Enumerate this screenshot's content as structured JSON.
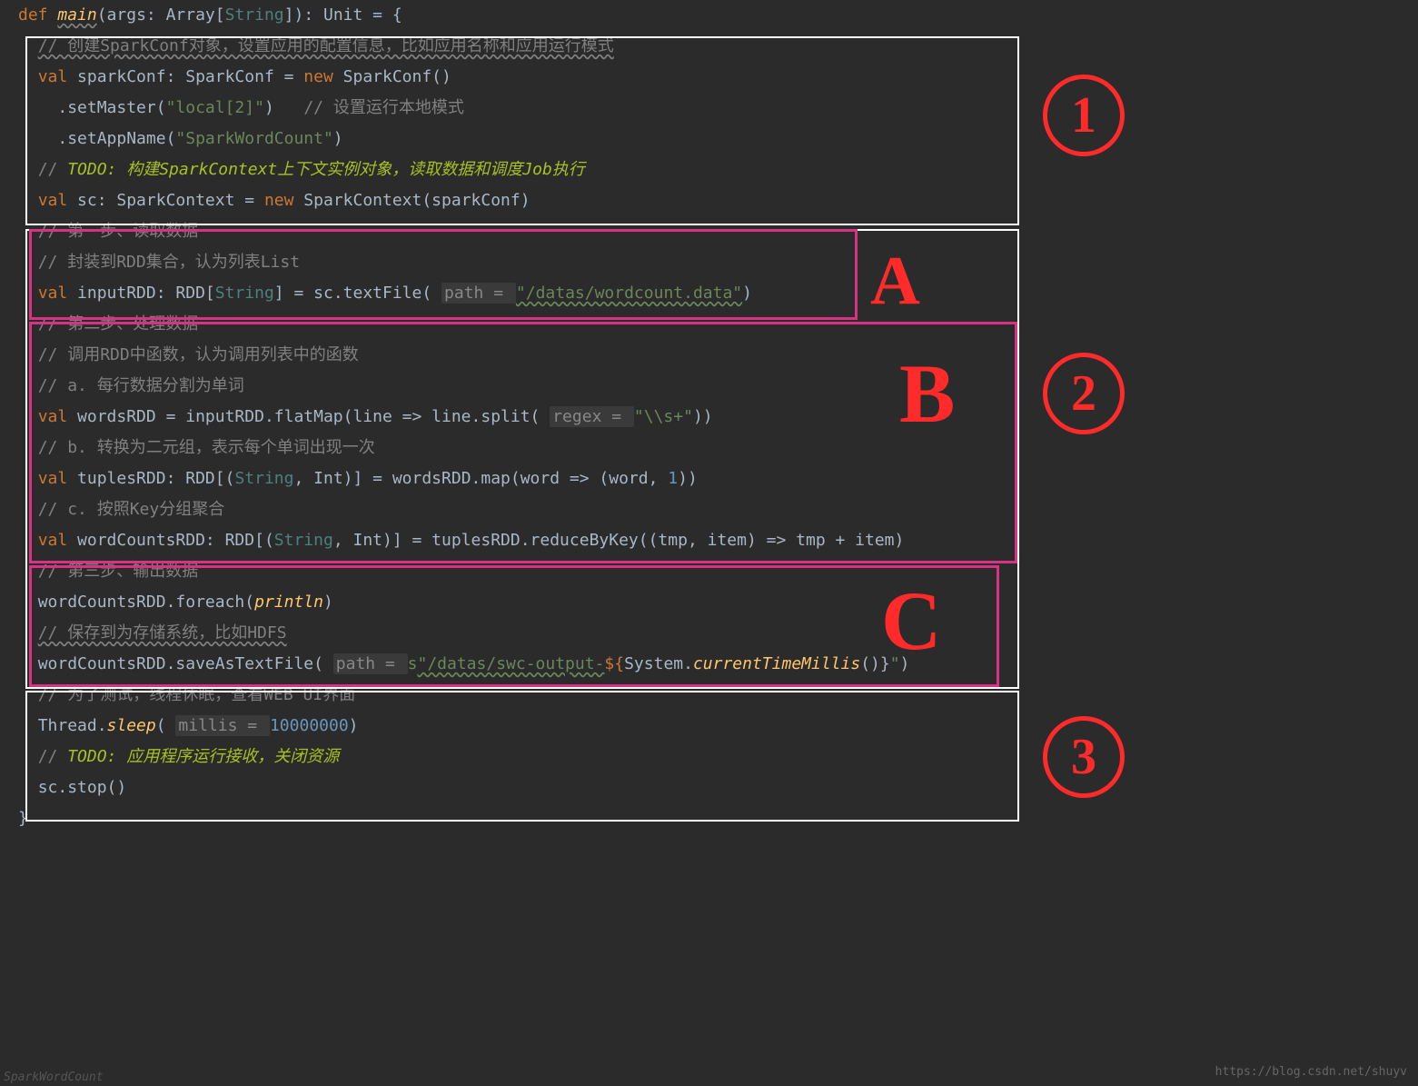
{
  "code": {
    "l1_def": "def",
    "l1_main": "main",
    "l1_args": "(args: Array[",
    "l1_string": "String",
    "l1_close": "]): Unit = {",
    "c1": "// 创建SparkConf对象，设置应用的配置信息，比如应用名称和应用运行模式",
    "l2_val": "val",
    "l2_name": " sparkConf: SparkConf = ",
    "l2_new": "new",
    "l2_ctor": " SparkConf()",
    "l3_call": ".setMaster(",
    "l3_str": "\"local[2]\"",
    "l3_close": ")   ",
    "c3": "// 设置运行本地模式",
    "l4_call": ".setAppName(",
    "l4_str": "\"SparkWordCount\"",
    "l4_close": ")",
    "c5a": "// ",
    "c5_todo": "TODO: 构建SparkContext上下文实例对象，读取数据和调度Job执行",
    "l6_val": "val",
    "l6_rest": " sc: SparkContext = ",
    "l6_new": "new",
    "l6_ctor": " SparkContext(sparkConf)",
    "cA1": "// 第一步、读取数据",
    "cA2": "// 封装到RDD集合，认为列表List",
    "lA3_val": "val",
    "lA3_rest1": " inputRDD: RDD[",
    "lA3_string": "String",
    "lA3_rest2": "] = sc.textFile( ",
    "lA3_param": "path = ",
    "lA3_str": "\"/datas/wordcount.data\"",
    "lA3_close": ")",
    "cB1": "// 第二步、处理数据",
    "cB2": "// 调用RDD中函数，认为调用列表中的函数",
    "cB3": "// a. 每行数据分割为单词",
    "lB4_val": "val",
    "lB4_rest": " wordsRDD = inputRDD.flatMap(line => line.split( ",
    "lB4_param": "regex = ",
    "lB4_str": "\"\\\\s+\"",
    "lB4_close": "))",
    "cB5": "// b. 转换为二元组，表示每个单词出现一次",
    "lB6_val": "val",
    "lB6_rest1": " tuplesRDD: RDD[(",
    "lB6_string": "String",
    "lB6_rest2": ", Int)] = wordsRDD.map(word => (word, ",
    "lB6_num": "1",
    "lB6_close": "))",
    "cB7": "// c. 按照Key分组聚合",
    "lB8_val": "val",
    "lB8_rest1": " wordCountsRDD: RDD[(",
    "lB8_string": "String",
    "lB8_rest2": ", Int)] = tuplesRDD.reduceByKey((tmp, item) => tmp + item)",
    "cC1": "// 第三步、输出数据",
    "lC2_call": "wordCountsRDD.foreach(",
    "lC2_fn": "println",
    "lC2_close": ")",
    "cC3": "// 保存到为存储系统，比如HDFS",
    "lC4_call": "wordCountsRDD.saveAsTextFile( ",
    "lC4_param": "path = ",
    "lC4_s": "s",
    "lC4_str1": "\"/datas/swc-output-",
    "lC4_interp_open": "${",
    "lC4_interp": "System.",
    "lC4_interp_fn": "currentTimeMillis",
    "lC4_interp_close": "()}",
    "lC4_str2": "\"",
    "lC4_close": ")",
    "cD1": "// 为了测试，线程休眠，查看WEB UI界面",
    "lD2_call": "Thread.",
    "lD2_fn": "sleep",
    "lD2_open": "( ",
    "lD2_param": "millis = ",
    "lD2_num": "10000000",
    "lD2_close": ")",
    "cD3a": "// ",
    "cD3_todo": "TODO: 应用程序运行接收，关闭资源",
    "lD4": "sc.stop()",
    "lEnd": "}"
  },
  "labels": {
    "A": "A",
    "B": "B",
    "C": "C",
    "n1": "1",
    "n2": "2",
    "n3": "3"
  },
  "watermark": "https://blog.csdn.net/shuyv",
  "status": "SparkWordCount"
}
